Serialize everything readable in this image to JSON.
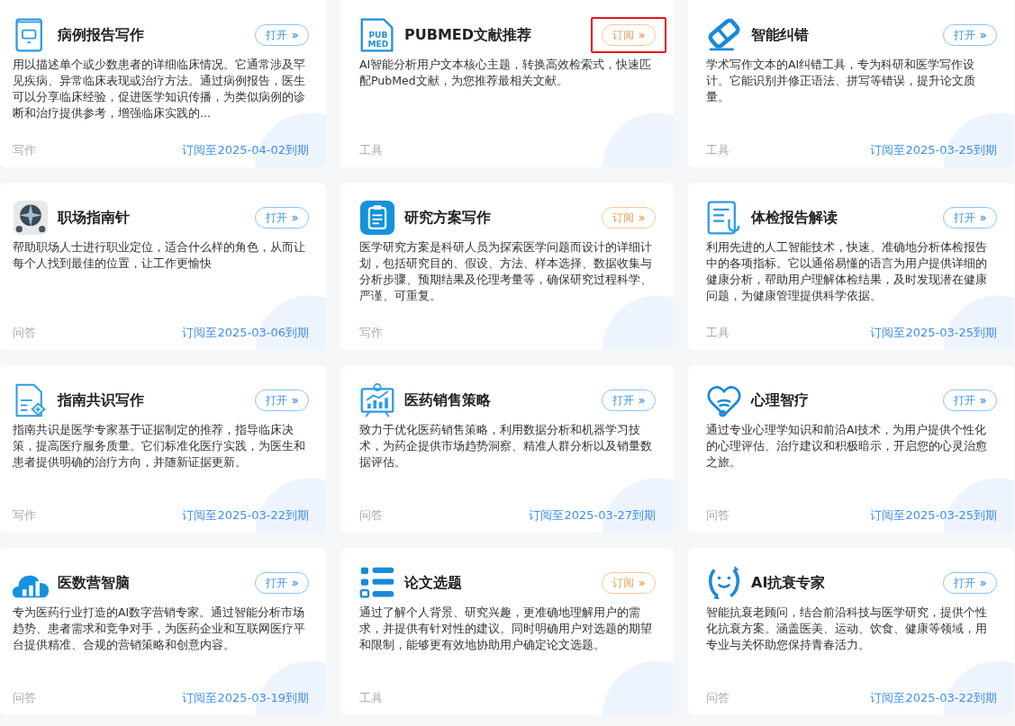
{
  "cards": [
    {
      "title": "病例报告写作",
      "button": {
        "kind": "open",
        "label": "打开"
      },
      "highlighted": false,
      "description": "用以描述单个或少数患者的详细临床情况。它通常涉及罕见疾病、异常临床表现或治疗方法。通过病例报告，医生可以分享临床经验，促进医学知识传播，为类似病例的诊断和治疗提供参考，增强临床实践的...",
      "category": "写作",
      "expiry": "订阅至2025-04-02到期"
    },
    {
      "title": "PUBMED文献推荐",
      "logo_lines": [
        "PUB",
        "MED"
      ],
      "button": {
        "kind": "subscribe",
        "label": "订阅"
      },
      "highlighted": true,
      "description": "AI智能分析用户文本核心主题，转换高效检索式，快速匹配PubMed文献，为您推荐最相关文献。",
      "category": "工具"
    },
    {
      "title": "智能纠错",
      "button": {
        "kind": "open",
        "label": "打开"
      },
      "highlighted": false,
      "description": "学术写作文本的AI纠错工具，专为科研和医学写作设计。它能识别并修正语法、拼写等错误，提升论文质量。",
      "category": "工具",
      "expiry": "订阅至2025-03-25到期"
    },
    {
      "title": "职场指南针",
      "button": {
        "kind": "open",
        "label": "打开"
      },
      "highlighted": false,
      "description": "帮助职场人士进行职业定位，适合什么样的角色，从而让每个人找到最佳的位置，让工作更愉快",
      "category": "问答",
      "expiry": "订阅至2025-03-06到期"
    },
    {
      "title": "研究方案写作",
      "button": {
        "kind": "subscribe",
        "label": "订阅"
      },
      "highlighted": false,
      "description": "医学研究方案是科研人员为探索医学问题而设计的详细计划，包括研究目的、假设、方法、样本选择、数据收集与分析步骤、预期结果及伦理考量等，确保研究过程科学、严谨、可重复。",
      "category": "写作"
    },
    {
      "title": "体检报告解读",
      "button": {
        "kind": "open",
        "label": "打开"
      },
      "highlighted": false,
      "description": "利用先进的人工智能技术，快速、准确地分析体检报告中的各项指标。它以通俗易懂的语言为用户提供详细的健康分析，帮助用户理解体检结果，及时发现潜在健康问题，为健康管理提供科学依据。",
      "category": "工具",
      "expiry": "订阅至2025-03-25到期"
    },
    {
      "title": "指南共识写作",
      "button": {
        "kind": "open",
        "label": "打开"
      },
      "highlighted": false,
      "description": "指南共识是医学专家基于证据制定的推荐，指导临床决策，提高医疗服务质量。它们标准化医疗实践，为医生和患者提供明确的治疗方向，并随新证据更新。",
      "category": "写作",
      "expiry": "订阅至2025-03-22到期"
    },
    {
      "title": "医药销售策略",
      "button": {
        "kind": "open",
        "label": "打开"
      },
      "highlighted": false,
      "description": "致力于优化医药销售策略，利用数据分析和机器学习技术，为药企提供市场趋势洞察、精准人群分析以及销量数据评估。",
      "category": "问答",
      "expiry": "订阅至2025-03-27到期"
    },
    {
      "title": "心理智疗",
      "button": {
        "kind": "open",
        "label": "打开"
      },
      "highlighted": false,
      "description": "通过专业心理学知识和前沿AI技术，为用户提供个性化的心理评估、治疗建议和积极暗示，开启您的心灵治愈之旅。",
      "category": "问答",
      "expiry": "订阅至2025-03-25到期"
    },
    {
      "title": "医数营智脑",
      "button": {
        "kind": "open",
        "label": "打开"
      },
      "highlighted": false,
      "description": "专为医药行业打造的AI数字营销专家。通过智能分析市场趋势、患者需求和竞争对手，为医药企业和互联网医疗平台提供精准、合规的营销策略和创意内容。",
      "category": "问答",
      "expiry": "订阅至2025-03-19到期"
    },
    {
      "title": "论文选题",
      "button": {
        "kind": "subscribe",
        "label": "订阅"
      },
      "highlighted": false,
      "description": "通过了解个人背景、研究兴趣，更准确地理解用户的需求，并提供有针对性的建议。同时明确用户对选题的期望和限制，能够更有效地协助用户确定论文选题。",
      "category": "工具"
    },
    {
      "title": "AI抗衰专家",
      "button": {
        "kind": "open",
        "label": "打开"
      },
      "highlighted": false,
      "description": "智能抗衰老顾问，结合前沿科技与医学研究，提供个性化抗衰方案。涵盖医美、运动、饮食、健康等领域，用专业与关怀助您保持青春活力。",
      "category": "问答",
      "expiry": "订阅至2025-03-22到期"
    }
  ]
}
